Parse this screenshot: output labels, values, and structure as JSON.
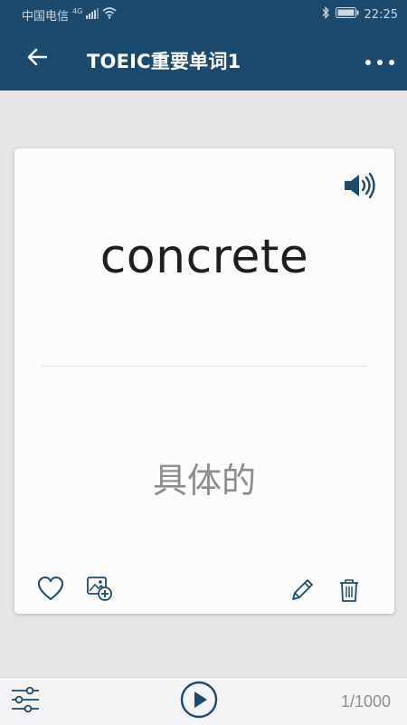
{
  "status_bar": {
    "carrier": "中国电信",
    "network": "4G",
    "time": "22:25"
  },
  "app_bar": {
    "title": "TOEIC重要单词1",
    "back_icon": "arrow-left-icon",
    "more_icon": "more-dots-icon"
  },
  "card": {
    "word": "concrete",
    "meaning": "具体的",
    "speaker_icon": "speaker-icon",
    "actions": [
      "heart-icon",
      "add-image-icon",
      "edit-pencil-icon",
      "trash-icon"
    ]
  },
  "bottom_bar": {
    "filter_icon": "sliders-icon",
    "play_icon": "play-icon",
    "counter": "1/1000"
  },
  "colors": {
    "primary": "#1b4a6e",
    "background": "#e6e6e9",
    "card": "#fcfcfc",
    "word_text": "#1e1e1e",
    "meaning_text": "#8c8c8c",
    "icon": "#1b4a6e"
  }
}
